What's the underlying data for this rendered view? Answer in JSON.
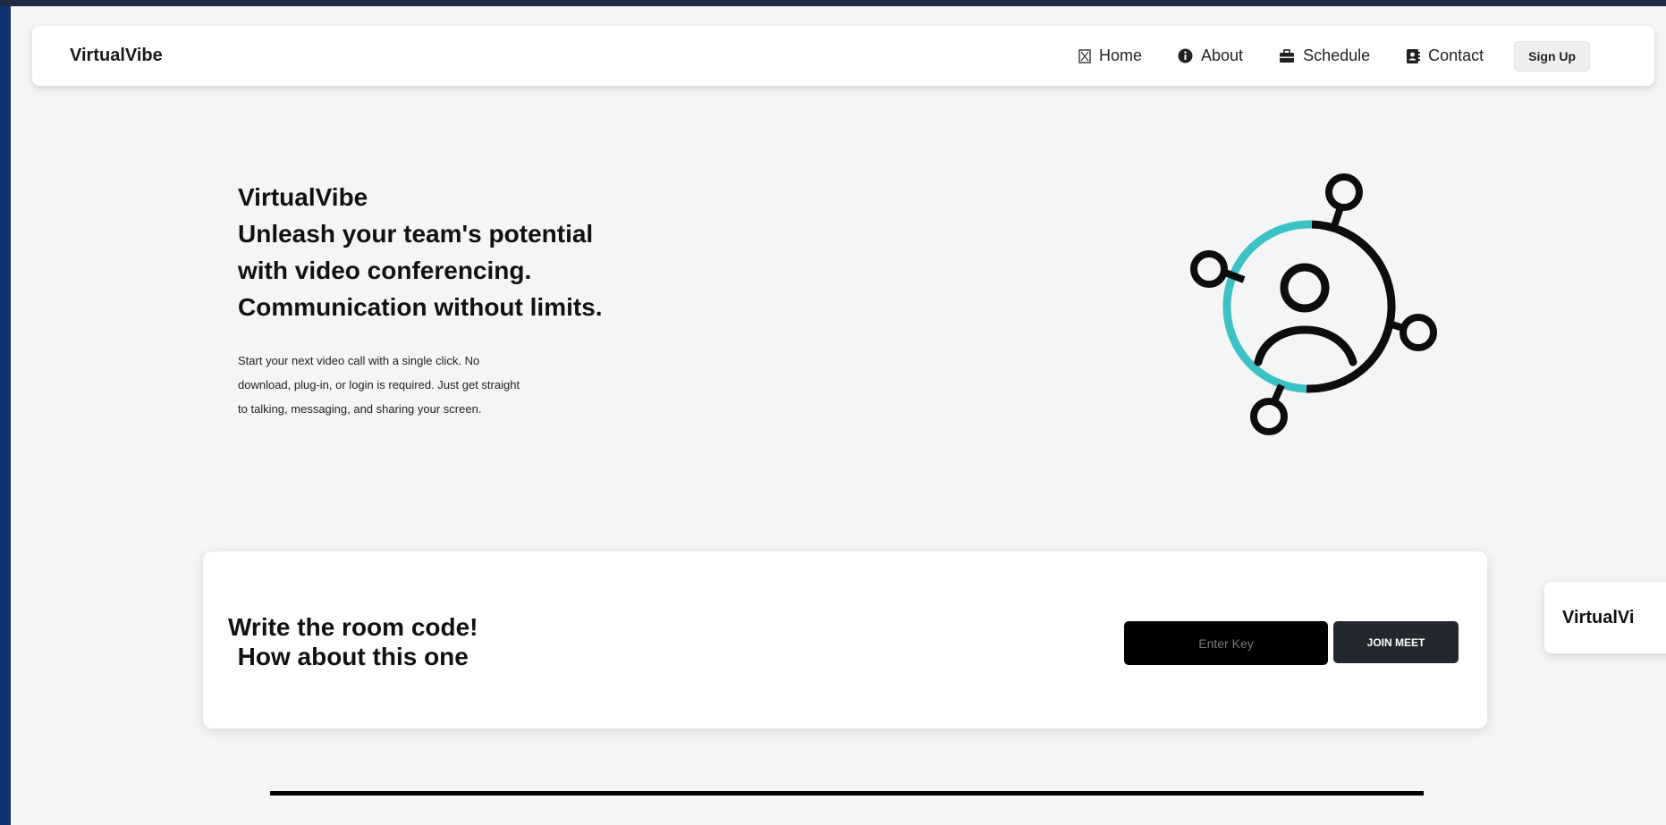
{
  "navbar": {
    "brand": "VirtualVibe",
    "items": [
      {
        "label": "Home",
        "icon": "hourglass-icon"
      },
      {
        "label": "About",
        "icon": "info-circle-icon"
      },
      {
        "label": "Schedule",
        "icon": "briefcase-icon"
      },
      {
        "label": "Contact",
        "icon": "address-book-icon"
      }
    ],
    "signup_label": "Sign Up"
  },
  "hero": {
    "title_lines": [
      "VirtualVibe",
      "Unleash your team's potential",
      "with video conferencing.",
      "Communication without limits."
    ],
    "description_lines": [
      "Start your next video call with a single click. No",
      "download, plug-in, or login is required. Just get straight",
      "to talking, messaging, and sharing your screen."
    ],
    "illustration": {
      "icon": "network-user-icon",
      "accent_color": "#3cc2c4"
    }
  },
  "room": {
    "title_line1": "Write the room code!",
    "title_line2": "How about this one",
    "input_placeholder": "Enter Key",
    "input_value": "",
    "join_label": "JOIN MEET"
  },
  "peek_card": {
    "text": "VirtualVi"
  },
  "colors": {
    "outer_background": "#0f3470",
    "page_background": "#f4f5f6",
    "accent": "#3cc2c4"
  }
}
